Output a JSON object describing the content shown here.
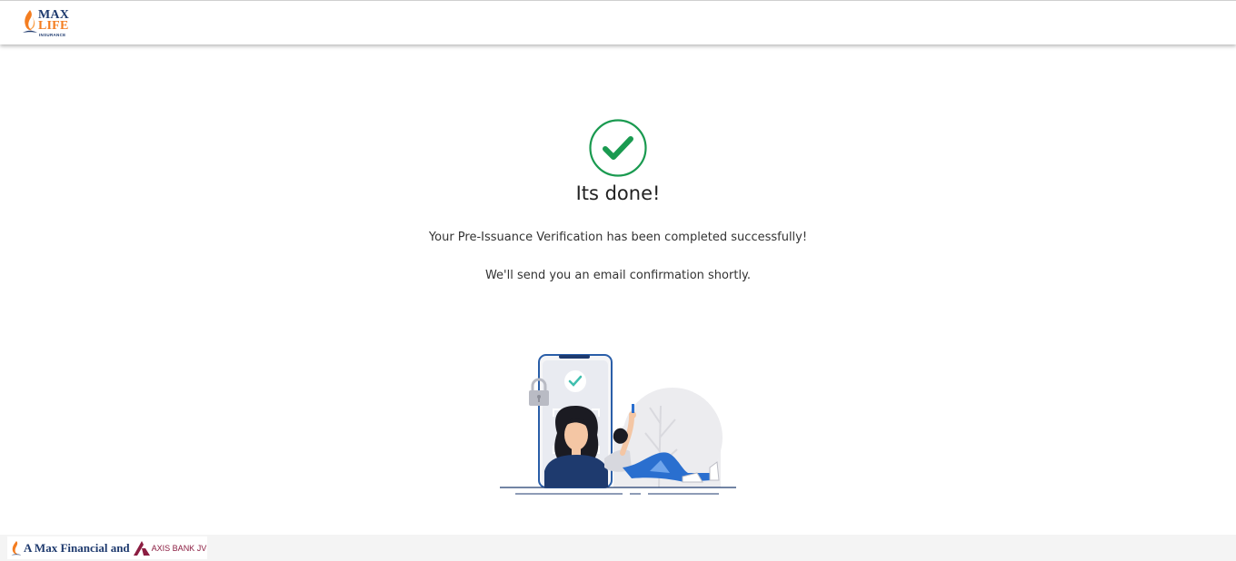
{
  "brand": {
    "logo_line1": "MAX",
    "logo_line2": "LIFE",
    "logo_line3": "INSURANCE",
    "navy": "#1e3a6e",
    "orange": "#f47d20"
  },
  "status": {
    "icon": "check-circle-icon",
    "color": "#1a9a50",
    "title": "Its done!",
    "message": "Your Pre-Issuance Verification has been completed successfully!",
    "followup": "We'll send you an email confirmation shortly."
  },
  "illustration": {
    "icon": "face-verification-illustration"
  },
  "footer": {
    "jv_prefix": "A Max Financial and",
    "jv_suffix": "AXIS BANK JV",
    "axis_color": "#8b1d41"
  }
}
